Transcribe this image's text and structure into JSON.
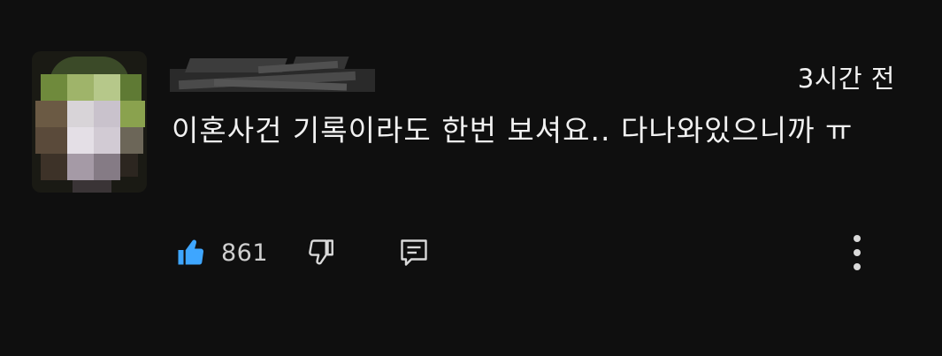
{
  "comment": {
    "author": "",
    "timestamp": "3시간 전",
    "text": "이혼사건 기록이라도 한번 보셔요.. 다나와있으니까 ㅠ",
    "like_count": "861"
  },
  "icons": {
    "like": "thumbs-up-filled-icon",
    "dislike": "thumbs-down-outline-icon",
    "reply": "reply-comment-icon",
    "menu": "more-vertical-icon"
  },
  "colors": {
    "background": "#0f0f0f",
    "text": "#f1f1f1",
    "like_active": "#3ea6ff",
    "icon": "#d9d9d9"
  }
}
